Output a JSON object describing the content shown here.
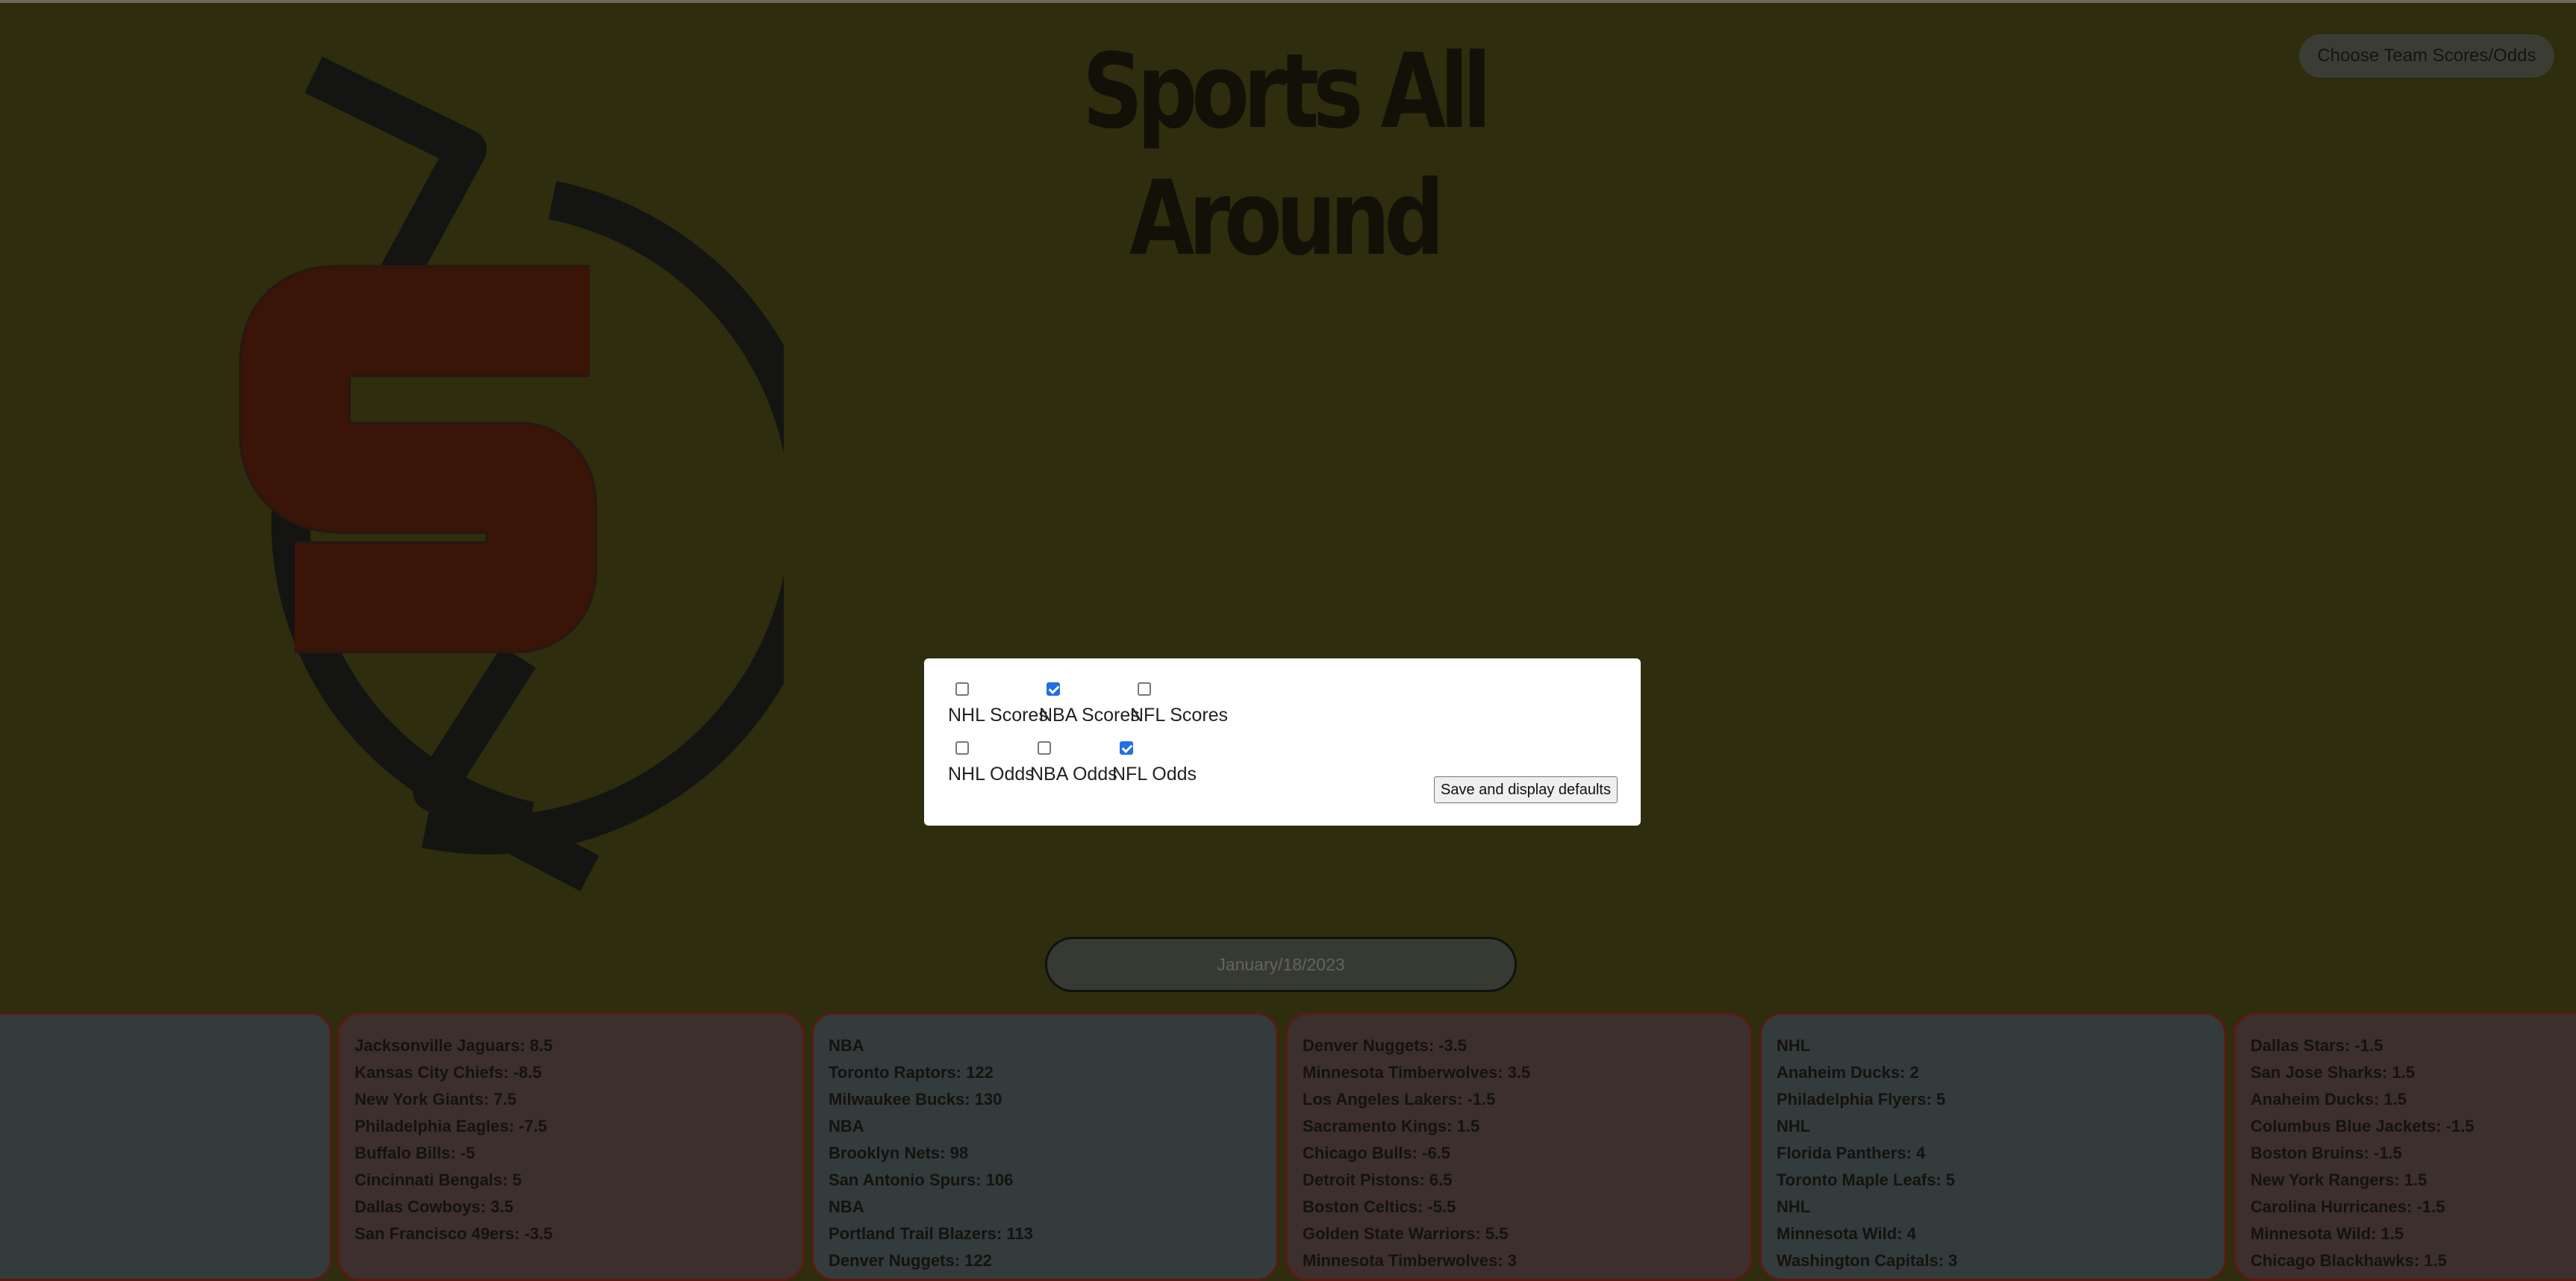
{
  "header": {
    "title": "Sports All Around",
    "choose_button": "Choose Team Scores/Odds"
  },
  "logo": {
    "letter": "S"
  },
  "defaults_modal": {
    "options_row1": [
      {
        "label": "NHL Scores",
        "checked": false
      },
      {
        "label": "NBA Scores",
        "checked": true
      },
      {
        "label": "NFL Scores",
        "checked": false
      }
    ],
    "options_row2": [
      {
        "label": "NHL Odds",
        "checked": false
      },
      {
        "label": "NBA Odds",
        "checked": false
      },
      {
        "label": "NFL Odds",
        "checked": true
      }
    ],
    "save_button": "Save and display defaults"
  },
  "date_display": "January/18/2023",
  "cards": [
    {
      "lines": []
    },
    {
      "lines": [
        "Jacksonville Jaguars: 8.5",
        "Kansas City Chiefs: -8.5",
        "New York Giants: 7.5",
        "Philadelphia Eagles: -7.5",
        "Buffalo Bills: -5",
        "Cincinnati Bengals: 5",
        "Dallas Cowboys: 3.5",
        "San Francisco 49ers: -3.5"
      ]
    },
    {
      "lines": [
        "NBA",
        "Toronto Raptors: 122",
        "Milwaukee Bucks: 130",
        "NBA",
        "Brooklyn Nets: 98",
        "San Antonio Spurs: 106",
        "NBA",
        "Portland Trail Blazers: 113",
        "Denver Nuggets: 122"
      ]
    },
    {
      "lines": [
        "Denver Nuggets: -3.5",
        "Minnesota Timberwolves: 3.5",
        "Los Angeles Lakers: -1.5",
        "Sacramento Kings: 1.5",
        "Chicago Bulls: -6.5",
        "Detroit Pistons: 6.5",
        "Boston Celtics: -5.5",
        "Golden State Warriors: 5.5",
        "Minnesota Timberwolves: 3"
      ]
    },
    {
      "lines": [
        "NHL",
        "Anaheim Ducks: 2",
        "Philadelphia Flyers: 5",
        "NHL",
        "Florida Panthers: 4",
        "Toronto Maple Leafs: 5",
        "NHL",
        "Minnesota Wild: 4",
        "Washington Capitals: 3"
      ]
    },
    {
      "lines": [
        "Dallas Stars: -1.5",
        "San Jose Sharks: 1.5",
        "Anaheim Ducks: 1.5",
        "Columbus Blue Jackets: -1.5",
        "Boston Bruins: -1.5",
        "New York Rangers: 1.5",
        "Carolina Hurricanes: -1.5",
        "Minnesota Wild: 1.5",
        "Chicago Blackhawks: 1.5"
      ]
    }
  ]
}
